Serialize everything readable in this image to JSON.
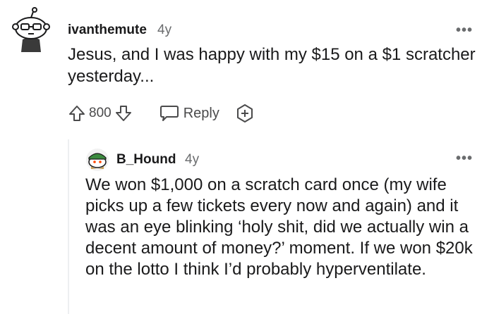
{
  "comment1": {
    "username": "ivanthemute",
    "age": "4y",
    "more": "•••",
    "body": "Jesus, and I was happy with my $15 on a $1 scratcher yesterday...",
    "votes": "800",
    "reply_label": "Reply"
  },
  "comment2": {
    "username": "B_Hound",
    "age": "4y",
    "more": "•••",
    "body": "We won $1,000 on a scratch card once (my wife picks up a few tickets every now and again) and it was an eye blinking ‘holy shit, did we actually win a decent amount of money?’ moment. If we won $20k on the lotto I think I’d probably hyperventilate."
  },
  "icons": {
    "upvote": "upvote-arrow-icon",
    "downvote": "downvote-arrow-icon",
    "reply": "speech-bubble-icon",
    "award": "award-plus-icon",
    "more": "ellipsis-icon"
  },
  "colors": {
    "text": "#1a1a1b",
    "meta": "#6a6c6e",
    "icon": "#4a4a4b",
    "thread_line": "#edeff1"
  }
}
